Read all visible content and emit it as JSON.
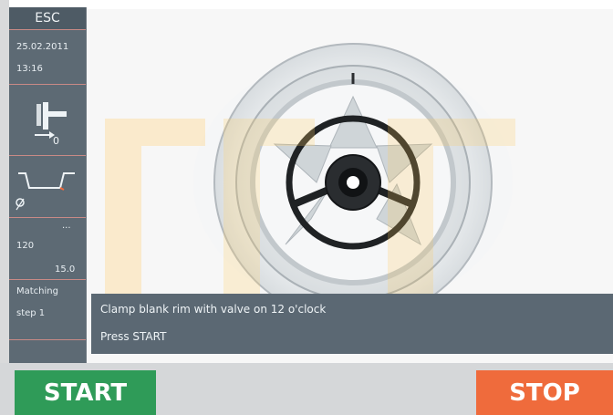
{
  "sidebar": {
    "esc_label": "ESC",
    "date": "25.02.2011",
    "time": "13:16",
    "offset_value": "0",
    "dots": "...",
    "value_left": "120",
    "value_right": "15.0",
    "mode_label": "Matching",
    "step_label": "step 1"
  },
  "message": {
    "line1": "Clamp blank rim with valve on 12 o'clock",
    "line2": "Press START"
  },
  "buttons": {
    "start_label": "START",
    "stop_label": "STOP"
  },
  "colors": {
    "start": "#2f9b58",
    "stop": "#ef6b3c",
    "sidebar": "#5d6a74"
  }
}
